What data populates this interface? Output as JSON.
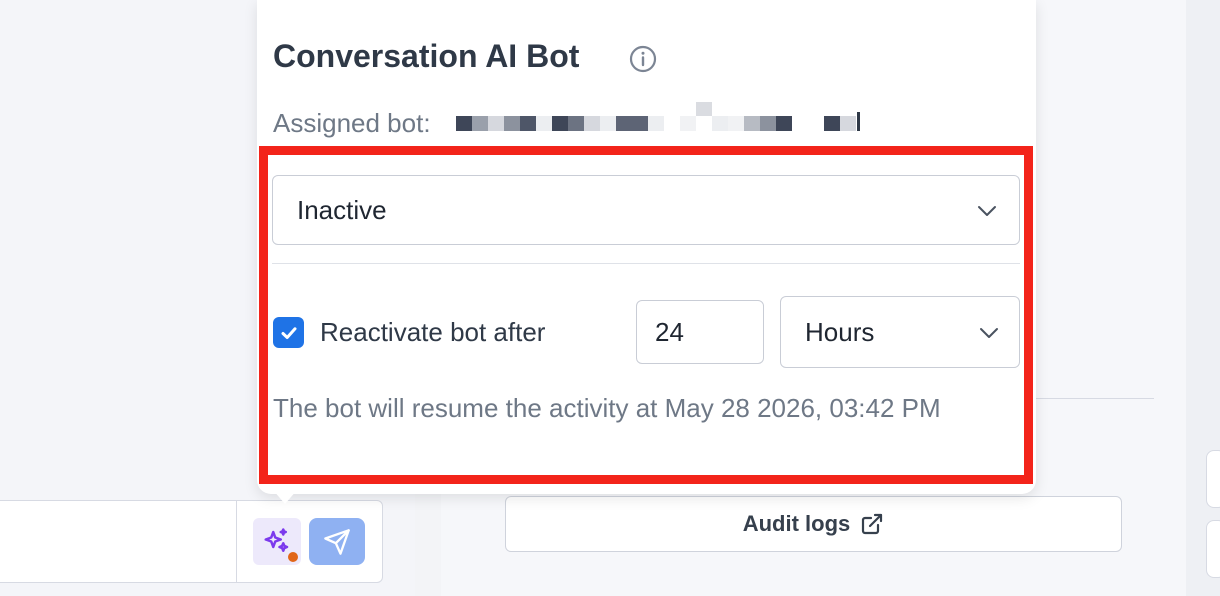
{
  "popover": {
    "title": "Conversation AI Bot",
    "assigned_label": "Assigned bot:",
    "status_value": "Inactive",
    "reactivate_label": "Reactivate bot after",
    "reactivate_checked": true,
    "duration_value": "24",
    "duration_unit": "Hours",
    "resume_text": "The bot will resume the activity at May 28 2026, 03:42 PM"
  },
  "background": {
    "audit_logs_label": "Audit logs"
  },
  "icons": {
    "info": "info-icon",
    "chevron": "chevron-down-icon",
    "check": "check-icon",
    "ai": "sparkles-icon",
    "send": "send-icon",
    "external": "external-link-icon"
  },
  "colors": {
    "highlight": "#f3241a",
    "checkbox": "#1f73e6",
    "send_button": "#8fb1f2",
    "ai_button_bg": "#ede9fb",
    "ai_icon": "#7c3aed",
    "notification_dot": "#e16618"
  }
}
